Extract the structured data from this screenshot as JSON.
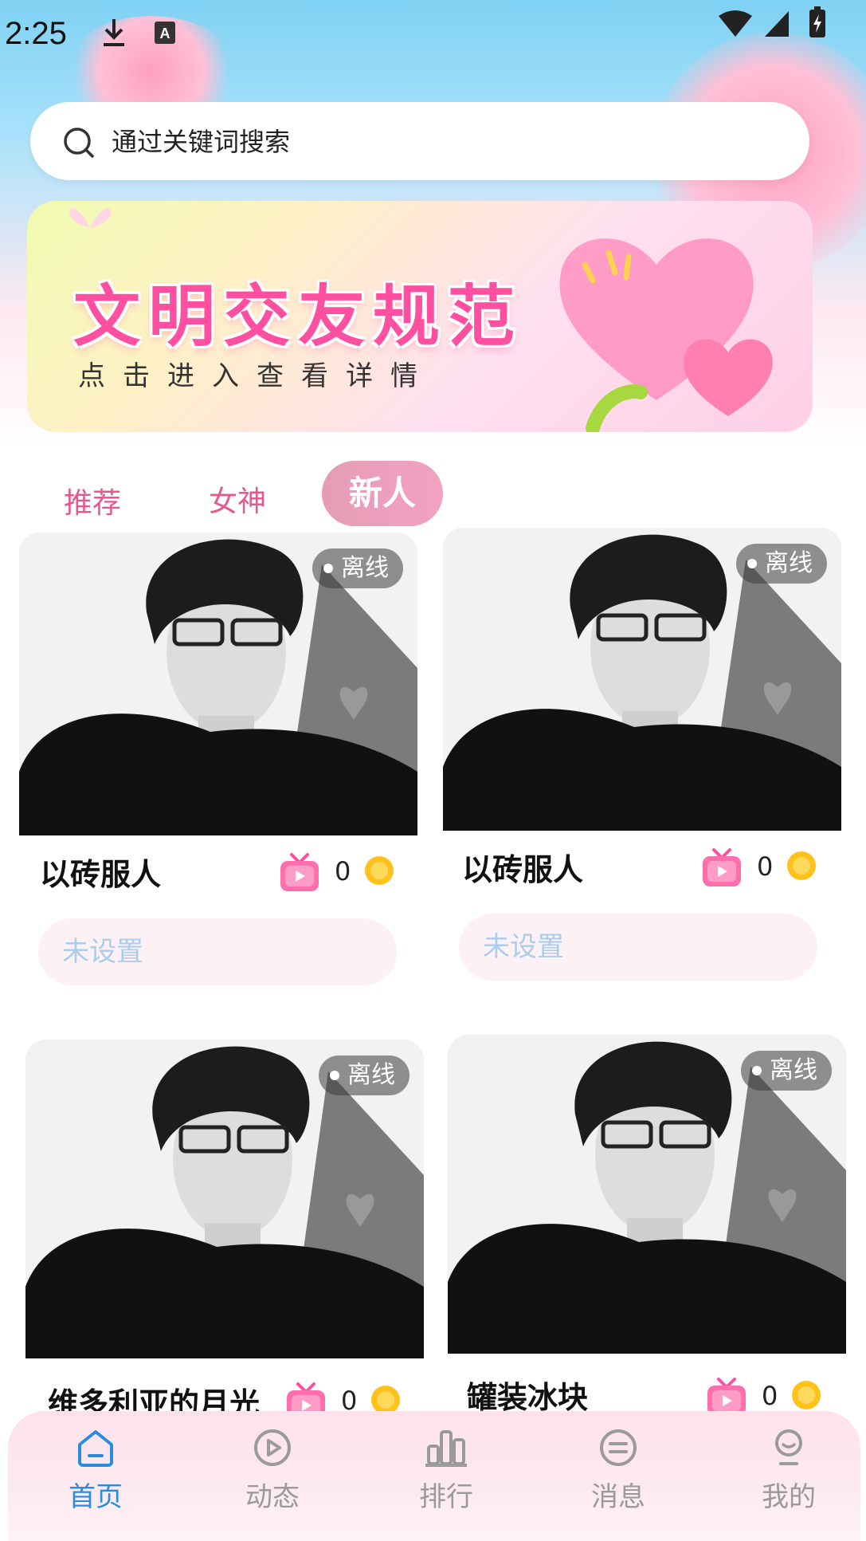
{
  "status_bar": {
    "time": "2:25"
  },
  "search": {
    "placeholder": "通过关键词搜索"
  },
  "banner": {
    "title": "文明交友规范",
    "subtitle": "点击进入查看详情"
  },
  "tabs": [
    {
      "label": "推荐",
      "active": false
    },
    {
      "label": "女神",
      "active": false
    },
    {
      "label": "新人",
      "active": true
    }
  ],
  "cards": [
    {
      "name": "以砖服人",
      "status": "离线",
      "coins": "0",
      "bio": "未设置"
    },
    {
      "name": "以砖服人",
      "status": "离线",
      "coins": "0",
      "bio": "未设置"
    },
    {
      "name": "维多利亚的月光",
      "status": "离线",
      "coins": "0",
      "bio": ""
    },
    {
      "name": "罐装冰块",
      "status": "离线",
      "coins": "0",
      "bio": ""
    }
  ],
  "bottom_nav": [
    {
      "label": "首页",
      "icon": "home-icon",
      "active": true
    },
    {
      "label": "动态",
      "icon": "play-icon",
      "active": false
    },
    {
      "label": "排行",
      "icon": "ranking-icon",
      "active": false
    },
    {
      "label": "消息",
      "icon": "message-icon",
      "active": false
    },
    {
      "label": "我的",
      "icon": "profile-icon",
      "active": false
    }
  ],
  "colors": {
    "accent_pink": "#e35a8e",
    "nav_active": "#2a8ce0",
    "bio_text": "#a9cdea"
  }
}
